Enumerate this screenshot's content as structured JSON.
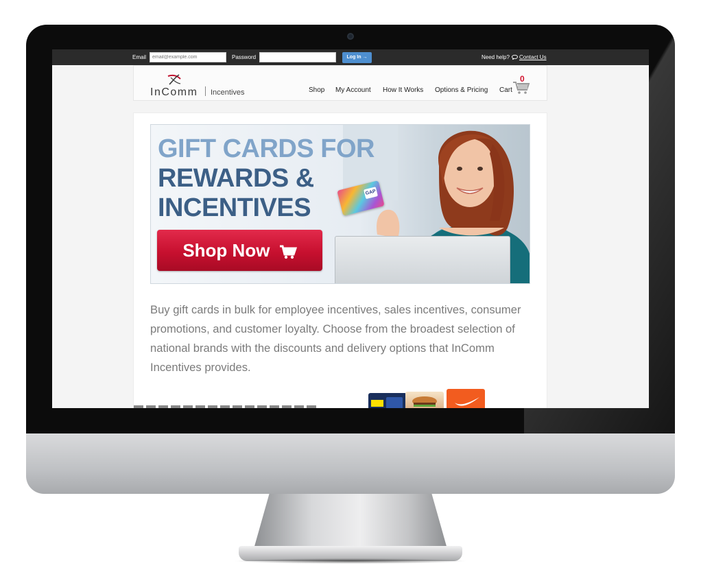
{
  "colors": {
    "top_bar": "#2b2b2b",
    "login_button": "#4e8fd0",
    "headline_light": "#80a4c9",
    "headline_dark": "#3c5f86",
    "shop_button": "#c7102f",
    "cart_count": "#d2132f",
    "body_text": "#7b7b7b"
  },
  "top_bar": {
    "email_label": "Email",
    "email_placeholder": "email@example.com",
    "password_label": "Password",
    "password_value": "",
    "login_button": "Log In →",
    "help_text": "Need help?",
    "contact_link": "Contact Us"
  },
  "header": {
    "logo_text": "InComm",
    "logo_subtext": "Incentives",
    "nav": [
      "Shop",
      "My Account",
      "How It Works",
      "Options & Pricing",
      "Cart"
    ],
    "cart_count": "0"
  },
  "hero": {
    "line1": "GIFT CARDS FOR",
    "line2": "REWARDS &",
    "line3": "INCENTIVES",
    "button": "Shop Now",
    "gift_card_brand": "GAP"
  },
  "intro_text": "Buy gift cards in bulk for employee incentives, sales incentives, consumer promotions, and customer loyalty. Choose from the broadest selection of national brands with the discounts and delivery options that InComm Incentives provides.",
  "gift_card_thumbs": [
    "Best Buy gift card",
    "Burger King gift card",
    "Nike gift card"
  ]
}
